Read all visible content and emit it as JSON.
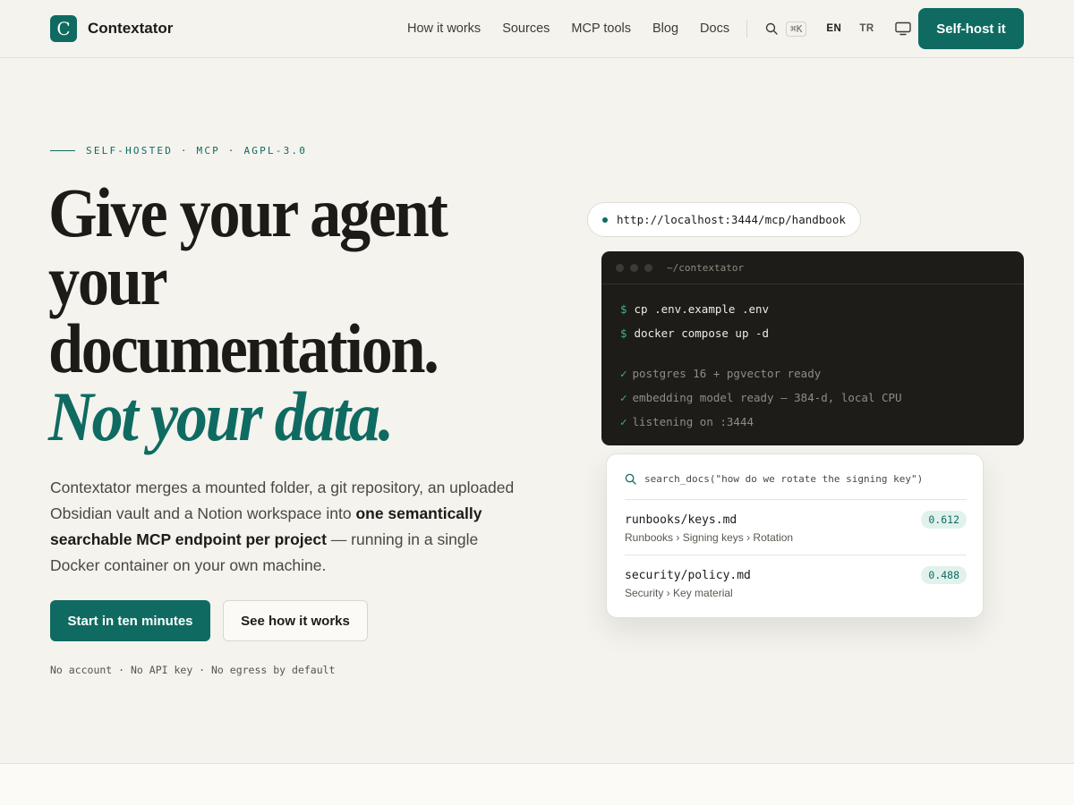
{
  "brand": {
    "name": "Contextator",
    "mark": "C"
  },
  "nav": {
    "links": [
      "How it works",
      "Sources",
      "MCP tools",
      "Blog",
      "Docs"
    ],
    "shortcut": "⌘K",
    "lang_active": "EN",
    "lang_other": "TR",
    "cta": "Self-host it"
  },
  "hero": {
    "eyebrow": "SELF-HOSTED · MCP · AGPL-3.0",
    "headline": [
      "Give your agent",
      "your",
      "documentation."
    ],
    "headline_accent": "Not your data.",
    "lede_start": "Contextator merges a mounted folder, a git repository, an uploaded Obsidian vault and a Notion workspace into ",
    "lede_bold": "one semantically searchable MCP endpoint per project",
    "lede_end": " — running in a single Docker container on your own machine.",
    "primary_cta": "Start in ten minutes",
    "secondary_cta": "See how it works",
    "fine_print": "No account · No API key · No egress by default"
  },
  "endpoint": {
    "url": "http://localhost:3444/mcp/handbook"
  },
  "terminal": {
    "title": "~/contextator",
    "commands": [
      "cp .env.example .env",
      "docker compose up -d"
    ],
    "prompt": "$",
    "check": "✓",
    "outputs": [
      "postgres 16 + pgvector ready",
      "embedding model ready — 384-d, local CPU",
      "listening on :3444"
    ]
  },
  "results": {
    "query": "search_docs(\"how do we rotate the signing key\")",
    "items": [
      {
        "path": "runbooks/keys.md",
        "crumb": "Runbooks › Signing keys › Rotation",
        "score": "0.612"
      },
      {
        "path": "security/policy.md",
        "crumb": "Security › Key material",
        "score": "0.488"
      }
    ]
  },
  "colors": {
    "accent": "#0f6b61",
    "background": "#f4f3ee",
    "terminal": "#1d1c18"
  }
}
